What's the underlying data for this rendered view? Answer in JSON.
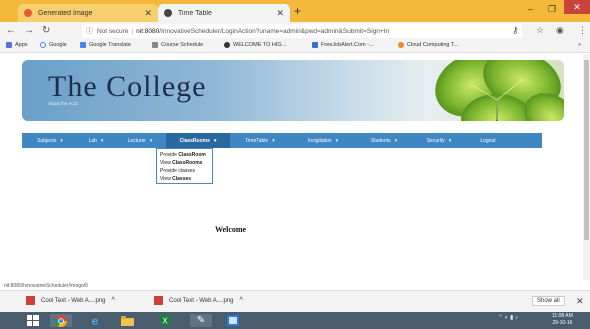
{
  "browser": {
    "tabs": [
      {
        "label": "Generated Image",
        "active": false
      },
      {
        "label": "Time Table",
        "active": true
      }
    ],
    "url": {
      "security": "Not secure",
      "host": "nit:8080",
      "path": "/InnovativeScheduler/LoginAction?uname=admin&pwd=admin&Submit=Sign+In"
    },
    "bookmarks": [
      {
        "label": "Apps",
        "icon": "apps-grid-icon"
      },
      {
        "label": "Google",
        "icon": "google-icon"
      },
      {
        "label": "Google Translate",
        "icon": "translate-icon"
      },
      {
        "label": "Course Schedule",
        "icon": "schedule-icon"
      },
      {
        "label": "WELCOME TO HIG...",
        "icon": "site-icon"
      },
      {
        "label": "FreeJobAlert.Com -...",
        "icon": "site-icon"
      },
      {
        "label": "Cloud Computing T...",
        "icon": "cloud-icon"
      }
    ],
    "bookmarks_more": "»",
    "status_url": "nit:8080/InnovativeScheduler/#nogo/0"
  },
  "page": {
    "banner": {
      "title": "The College",
      "subtitle": "About the ACD"
    },
    "menu": [
      {
        "label": "Subjects",
        "caret": "▾"
      },
      {
        "label": "Lab",
        "caret": "▾"
      },
      {
        "label": "Lecturer",
        "caret": "▾"
      },
      {
        "label": "ClassRooms",
        "caret": "▾",
        "active": true
      },
      {
        "label": "TimeTable",
        "caret": "▾"
      },
      {
        "label": "Invigilation",
        "caret": "▾"
      },
      {
        "label": "Students",
        "caret": "▾"
      },
      {
        "label": "Security",
        "caret": "▾"
      },
      {
        "label": "Logout",
        "caret": ""
      }
    ],
    "dropdown": {
      "items": [
        {
          "prefix": "Provide ",
          "bold": "ClassRoom",
          "suffix": ""
        },
        {
          "prefix": "View ",
          "bold": "ClassRooms",
          "suffix": ""
        },
        {
          "prefix": "Provide classes",
          "bold": "",
          "suffix": ""
        },
        {
          "prefix": "View ",
          "bold": "Classes",
          "suffix": ""
        }
      ]
    },
    "welcome": "Welcome"
  },
  "downloads": {
    "items": [
      {
        "label": "Cool Text - Web A....png",
        "icon": "image-file-icon"
      },
      {
        "label": "Cool Text - Web A....png",
        "icon": "image-file-icon"
      }
    ],
    "show_all": "Show all"
  },
  "taskbar": {
    "clock_time": "11:08 AM",
    "clock_date": "29-10-16"
  }
}
